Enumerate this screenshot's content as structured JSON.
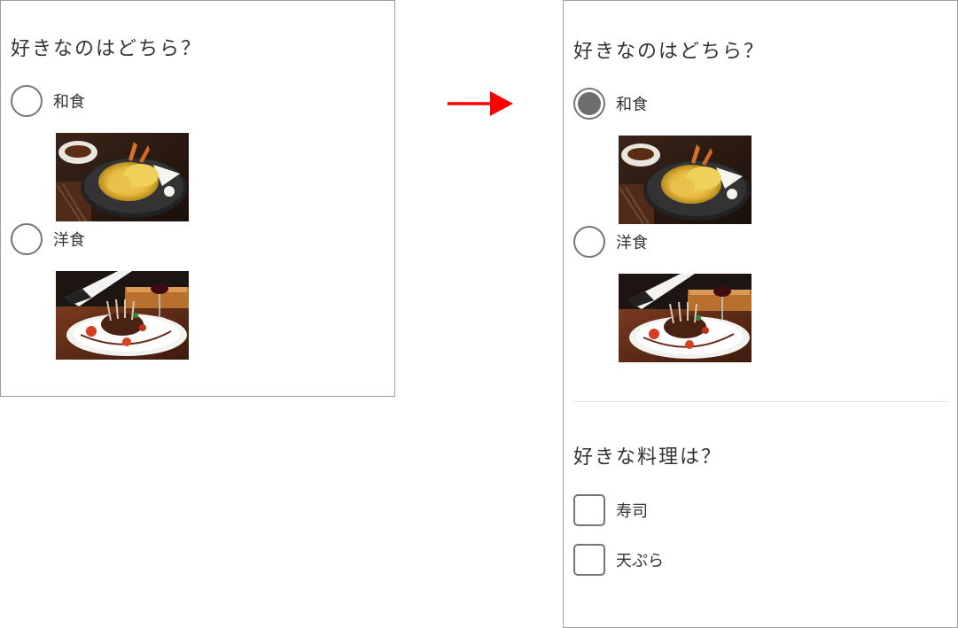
{
  "before": {
    "question": "好きなのはどちら？",
    "options": [
      {
        "label": "和食",
        "selected": false,
        "image": "tempura-photo"
      },
      {
        "label": "洋食",
        "selected": false,
        "image": "western-dinner-photo"
      }
    ]
  },
  "after": {
    "question1": "好きなのはどちら？",
    "options": [
      {
        "label": "和食",
        "selected": true,
        "image": "tempura-photo"
      },
      {
        "label": "洋食",
        "selected": false,
        "image": "western-dinner-photo"
      }
    ],
    "question2": "好きな料理は？",
    "checkboxes": [
      {
        "label": "寿司",
        "checked": false
      },
      {
        "label": "天ぷら",
        "checked": false
      }
    ]
  },
  "colors": {
    "arrow": "#ff0000",
    "control_border": "#757575",
    "selected_dot": "#6d6d6d",
    "panel_border": "#9e9e9e"
  }
}
